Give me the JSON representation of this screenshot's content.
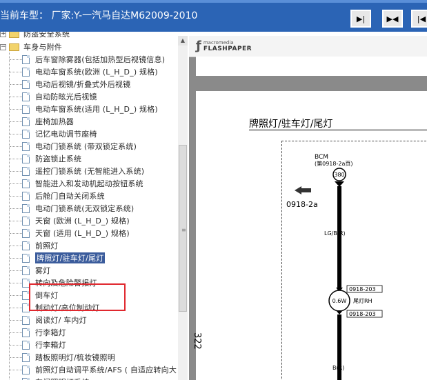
{
  "header": {
    "title": "当前车型：  厂家:Y-一汽马自达M62009-2010",
    "nav_buttons": [
      "next-page",
      "fit-page",
      "prev-page"
    ]
  },
  "tree": {
    "parent_partial": "防盗安全系统",
    "folder_label": "车身与附件",
    "items": [
      "后车窗除雾器(包括加热型后视镜信息)",
      "电动车窗系统(欧洲 (L_H_D_) 规格)",
      "电动后视镜/折叠式外后视镜",
      "自动防眩光后视镜",
      "电动车窗系统(适用 (L_H_D_) 规格)",
      "座椅加热器",
      "记忆电动调节座椅",
      "电动门锁系统 (带双锁定系统)",
      "防盗锁止系统",
      "遥控门锁系统 (无智能进入系统)",
      "智能进入和发动机起动按钮系统",
      "后舱门自动关闭系统",
      "电动门锁系统(无双锁定系统)",
      "天窗   (欧洲 (L_H_D_) 规格)",
      "天窗   (适用 (L_H_D_) 规格)",
      "前照灯",
      "牌照灯/驻车灯/尾灯",
      "雾灯",
      "转向及危险警报灯",
      "倒车灯",
      "制动灯/高位制动灯",
      "阅读灯/ 车内灯",
      "行李箱灯",
      "行李箱灯",
      "踏板照明灯/梳妆镜照明",
      "前照灯自动调平系统/AFS ( 自适应转向大",
      "车门照明灯系统"
    ],
    "selected_index": 16
  },
  "viewer": {
    "logo_top": "macromedia",
    "logo_bottom": "FLASHPAPER",
    "page_title": "牌照灯/驻车灯/尾灯",
    "page_number": "322",
    "diagram": {
      "bcm_label": "BCM",
      "bcm_ref": "(第0918-2a页)",
      "pin": "380",
      "ref_arrow": "0918-2a",
      "wire_top": "LG/B(R)",
      "connector_top": "0918-203",
      "bulb": "0.6W",
      "bulb_label": "尾灯RH",
      "connector_bottom": "0918-203",
      "wire_bottom": "B(R)"
    }
  },
  "colors": {
    "title_bar": "#2b64b5",
    "selection": "#3b5c9c",
    "highlight_box": "#e0282e",
    "viewer_bg": "#8a8a8a"
  }
}
